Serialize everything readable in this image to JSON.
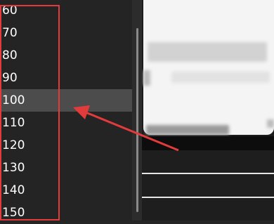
{
  "font_size_list": {
    "items": [
      "60",
      "70",
      "80",
      "90",
      "100",
      "110",
      "120",
      "130",
      "140",
      "150"
    ],
    "selected": "100"
  },
  "colors": {
    "highlight_box": "#e23b3b",
    "arrow": "#e23b3b",
    "selected_row": "#4c4c4c"
  }
}
